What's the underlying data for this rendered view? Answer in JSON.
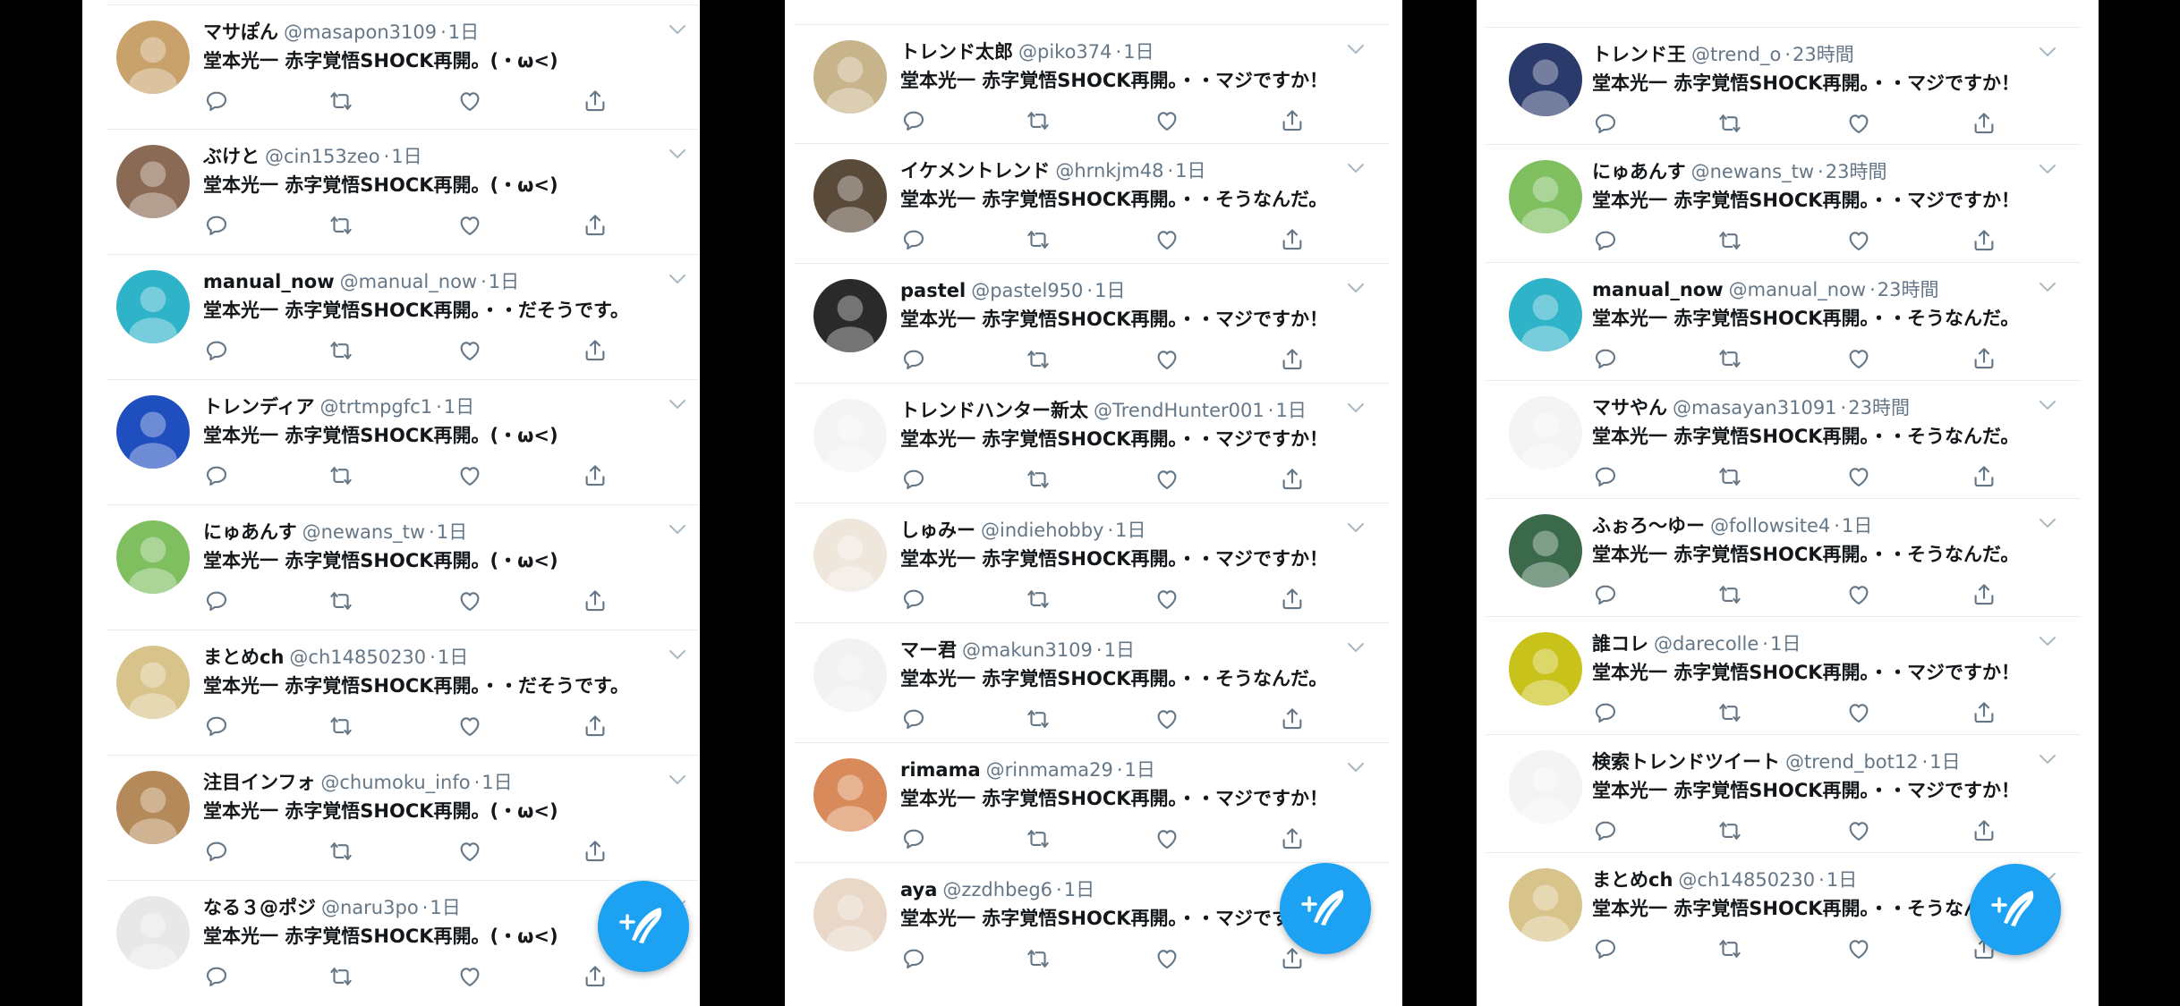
{
  "colors": {
    "accent": "#1da1f2",
    "text": "#14171a",
    "secondary": "#657786",
    "divider": "#e6ecf0"
  },
  "action_icons": [
    "reply-icon",
    "retweet-icon",
    "like-icon",
    "share-icon"
  ],
  "compose_icon": "compose-feather-icon",
  "columns": [
    {
      "tweets": [
        {
          "name": "マサぽん",
          "handle": "@masapon3109",
          "time": "1日",
          "text": "堂本光一 赤字覚悟SHOCK再開。(・ω<)",
          "avatar_color": "#c9a26b"
        },
        {
          "name": "ぶけと",
          "handle": "@cin153zeo",
          "time": "1日",
          "text": "堂本光一 赤字覚悟SHOCK再開。(・ω<)",
          "avatar_color": "#8a6a55"
        },
        {
          "name": "manual_now",
          "handle": "@manual_now",
          "time": "1日",
          "text": "堂本光一 赤字覚悟SHOCK再開。・・だそうです。",
          "avatar_color": "#2fb3c9"
        },
        {
          "name": "トレンディア",
          "handle": "@trtmpgfc1",
          "time": "1日",
          "text": "堂本光一 赤字覚悟SHOCK再開。(・ω<)",
          "avatar_color": "#1f4fbf"
        },
        {
          "name": "にゅあんす",
          "handle": "@newans_tw",
          "time": "1日",
          "text": "堂本光一 赤字覚悟SHOCK再開。(・ω<)",
          "avatar_color": "#7fbf5f"
        },
        {
          "name": "まとめch",
          "handle": "@ch14850230",
          "time": "1日",
          "text": "堂本光一 赤字覚悟SHOCK再開。・・だそうです。",
          "avatar_color": "#d8c48a"
        },
        {
          "name": "注目インフォ",
          "handle": "@chumoku_info",
          "time": "1日",
          "text": "堂本光一 赤字覚悟SHOCK再開。(・ω<)",
          "avatar_color": "#b58a5a"
        },
        {
          "name": "なる３@ポジ",
          "handle": "@naru3po",
          "time": "1日",
          "text": "堂本光一 赤字覚悟SHOCK再開。(・ω<)",
          "avatar_color": "#e8e8e8"
        }
      ]
    },
    {
      "tweets": [
        {
          "name": "トレンド太郎",
          "handle": "@piko374",
          "time": "1日",
          "text": "堂本光一 赤字覚悟SHOCK再開。・・マジですか！",
          "avatar_color": "#c8b48a"
        },
        {
          "name": "イケメントレンド",
          "handle": "@hrnkjm48",
          "time": "1日",
          "text": "堂本光一 赤字覚悟SHOCK再開。・・そうなんだ。",
          "avatar_color": "#5a4a3a"
        },
        {
          "name": "pastel",
          "handle": "@pastel950",
          "time": "1日",
          "text": "堂本光一 赤字覚悟SHOCK再開。・・マジですか！",
          "avatar_color": "#2a2a2a"
        },
        {
          "name": "トレンドハンター新太",
          "handle": "@TrendHunter001",
          "time": "1日",
          "text": "堂本光一 赤字覚悟SHOCK再開。・・マジですか！",
          "avatar_color": "#f4f4f4"
        },
        {
          "name": "しゅみー",
          "handle": "@indiehobby",
          "time": "1日",
          "text": "堂本光一 赤字覚悟SHOCK再開。・・マジですか！",
          "avatar_color": "#efe6dc"
        },
        {
          "name": "マー君",
          "handle": "@makun3109",
          "time": "1日",
          "text": "堂本光一 赤字覚悟SHOCK再開。・・そうなんだ。",
          "avatar_color": "#f2f2f2"
        },
        {
          "name": "rimama",
          "handle": "@rinmama29",
          "time": "1日",
          "text": "堂本光一 赤字覚悟SHOCK再開。・・マジですか！",
          "avatar_color": "#d98a5a"
        },
        {
          "name": "aya",
          "handle": "@zzdhbeg6",
          "time": "1日",
          "text": "堂本光一 赤字覚悟SHOCK再開。・・マジですか！",
          "avatar_color": "#e9d8c8"
        }
      ]
    },
    {
      "tweets": [
        {
          "name": "トレンド王",
          "handle": "@trend_o",
          "time": "23時間",
          "text": "堂本光一 赤字覚悟SHOCK再開。・・マジですか！",
          "avatar_color": "#2a3a6a"
        },
        {
          "name": "にゅあんす",
          "handle": "@newans_tw",
          "time": "23時間",
          "text": "堂本光一 赤字覚悟SHOCK再開。・・マジですか！",
          "avatar_color": "#7fbf5f"
        },
        {
          "name": "manual_now",
          "handle": "@manual_now",
          "time": "23時間",
          "text": "堂本光一 赤字覚悟SHOCK再開。・・そうなんだ。",
          "avatar_color": "#2fb3c9"
        },
        {
          "name": "マサやん",
          "handle": "@masayan31091",
          "time": "23時間",
          "text": "堂本光一 赤字覚悟SHOCK再開。・・そうなんだ。",
          "avatar_color": "#f4f4f4"
        },
        {
          "name": "ふぉろ〜ゆー",
          "handle": "@followsite4",
          "time": "1日",
          "text": "堂本光一 赤字覚悟SHOCK再開。・・そうなんだ。",
          "avatar_color": "#3a6a4a"
        },
        {
          "name": "誰コレ",
          "handle": "@darecolle",
          "time": "1日",
          "text": "堂本光一 赤字覚悟SHOCK再開。・・マジですか！",
          "avatar_color": "#c9c21a"
        },
        {
          "name": "検索トレンドツイート",
          "handle": "@trend_bot12",
          "time": "1日",
          "text": "堂本光一 赤字覚悟SHOCK再開。・・マジですか！",
          "avatar_color": "#f4f4f4"
        },
        {
          "name": "まとめch",
          "handle": "@ch14850230",
          "time": "1日",
          "text": "堂本光一 赤字覚悟SHOCK再開。・・そうなんだ。",
          "avatar_color": "#d8c48a"
        }
      ]
    }
  ]
}
